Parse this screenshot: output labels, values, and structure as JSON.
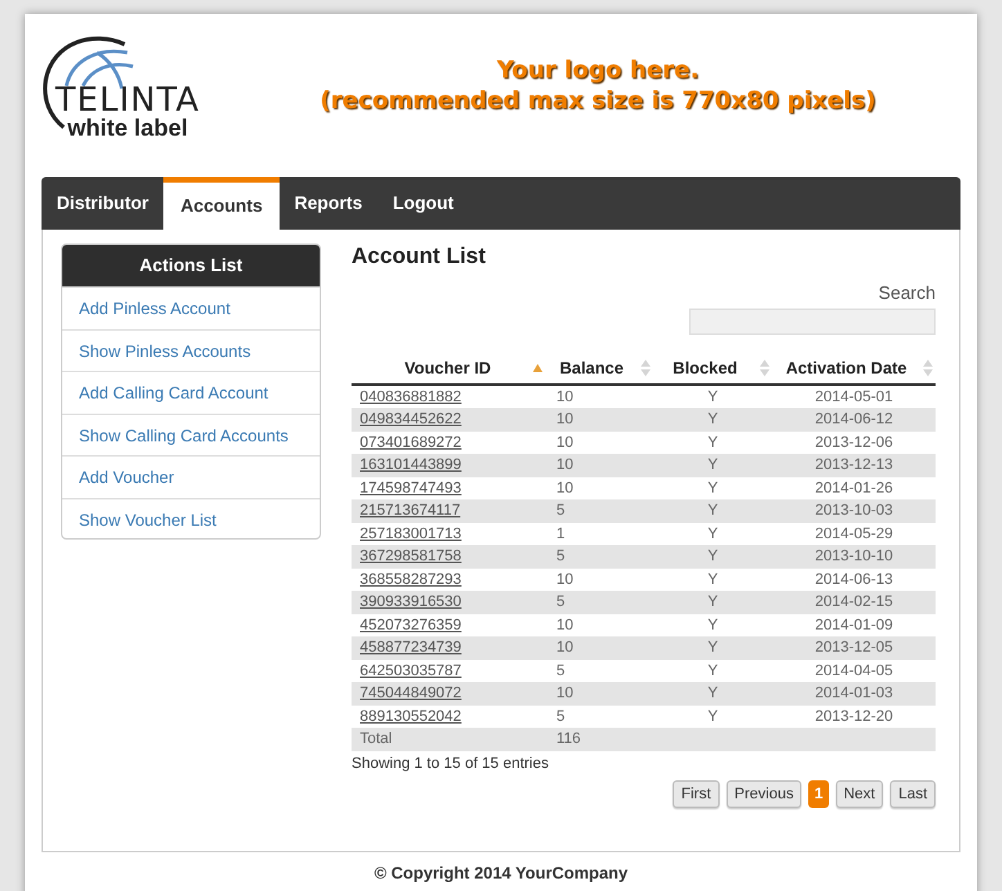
{
  "logo": {
    "name": "TELINTA",
    "tagline": "white label"
  },
  "banner": [
    "Your logo here.",
    "(recommended max size is 770x80 pixels)"
  ],
  "nav": [
    {
      "label": "Distributor",
      "selected": false
    },
    {
      "label": "Accounts",
      "selected": true
    },
    {
      "label": "Reports",
      "selected": false
    },
    {
      "label": "Logout",
      "selected": false
    }
  ],
  "sidebar": {
    "title": "Actions List",
    "items": [
      "Add Pinless Account",
      "Show Pinless Accounts",
      "Add Calling Card Account",
      "Show Calling Card Accounts",
      "Add Voucher",
      "Show Voucher List"
    ]
  },
  "main": {
    "title": "Account List",
    "search": {
      "label": "Search"
    },
    "table": {
      "columns": [
        {
          "label": "Voucher ID",
          "sorted": true
        },
        {
          "label": "Balance",
          "sorted": false
        },
        {
          "label": "Blocked",
          "sorted": false
        },
        {
          "label": "Activation Date",
          "sorted": false
        }
      ],
      "rows": [
        [
          "040836881882",
          "10",
          "Y",
          "2014-05-01"
        ],
        [
          "049834452622",
          "10",
          "Y",
          "2014-06-12"
        ],
        [
          "073401689272",
          "10",
          "Y",
          "2013-12-06"
        ],
        [
          "163101443899",
          "10",
          "Y",
          "2013-12-13"
        ],
        [
          "174598747493",
          "10",
          "Y",
          "2014-01-26"
        ],
        [
          "215713674117",
          "5",
          "Y",
          "2013-10-03"
        ],
        [
          "257183001713",
          "1",
          "Y",
          "2014-05-29"
        ],
        [
          "367298581758",
          "5",
          "Y",
          "2013-10-10"
        ],
        [
          "368558287293",
          "10",
          "Y",
          "2014-06-13"
        ],
        [
          "390933916530",
          "5",
          "Y",
          "2014-02-15"
        ],
        [
          "452073276359",
          "10",
          "Y",
          "2014-01-09"
        ],
        [
          "458877234739",
          "10",
          "Y",
          "2013-12-05"
        ],
        [
          "642503035787",
          "5",
          "Y",
          "2014-04-05"
        ],
        [
          "745044849072",
          "10",
          "Y",
          "2014-01-03"
        ],
        [
          "889130552042",
          "5",
          "Y",
          "2013-12-20"
        ]
      ],
      "total": {
        "label": "Total",
        "balance": "116"
      }
    },
    "info": "Showing 1 to 15 of 15 entries",
    "pagination": [
      {
        "label": "First",
        "selected": false
      },
      {
        "label": "Previous",
        "selected": false
      },
      {
        "label": "1",
        "selected": true
      },
      {
        "label": "Next",
        "selected": false
      },
      {
        "label": "Last",
        "selected": false
      }
    ]
  },
  "footer": "© Copyright 2014 YourCompany"
}
